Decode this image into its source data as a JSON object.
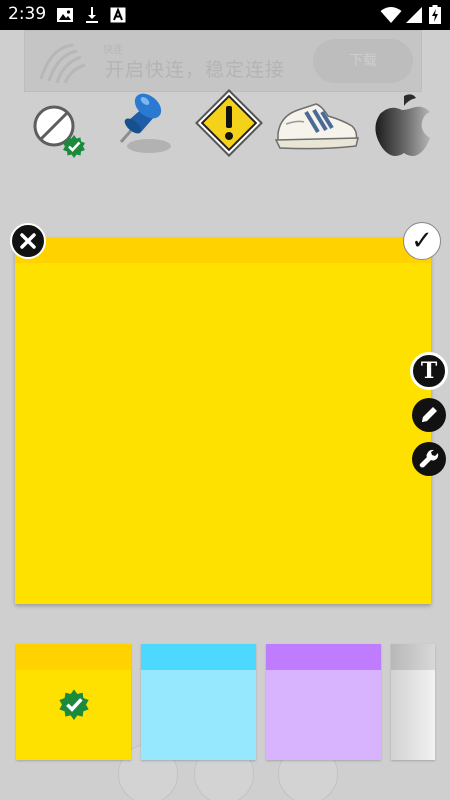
{
  "status_bar": {
    "time": "2:39",
    "icons": [
      "image-icon",
      "download-icon",
      "a-box-icon",
      "wifi-icon",
      "signal-icon",
      "battery-charging-icon"
    ]
  },
  "ad_banner": {
    "logo_small_text": "快连",
    "tagline": "开启快连，稳定连接",
    "button_label": "下载"
  },
  "stickers": [
    {
      "name": "no-sticker-icon"
    },
    {
      "name": "push-pin-icon"
    },
    {
      "name": "warning-sign-icon"
    },
    {
      "name": "sneaker-icon"
    },
    {
      "name": "apple-logo-icon"
    }
  ],
  "note": {
    "color": "#ffe100",
    "band_color": "#ffd200",
    "confirm_glyph": "✓"
  },
  "tools": {
    "text_tool_glyph": "T"
  },
  "swatches": [
    {
      "body": "#ffe100",
      "band": "#ffd200",
      "selected": true
    },
    {
      "body": "#96e8ff",
      "band": "#4dd8ff",
      "selected": false
    },
    {
      "body": "#d8b4ff",
      "band": "#c07cff",
      "selected": false
    },
    {
      "body": "#e6e6e6",
      "band": "#c8c8c8",
      "selected": false
    }
  ]
}
